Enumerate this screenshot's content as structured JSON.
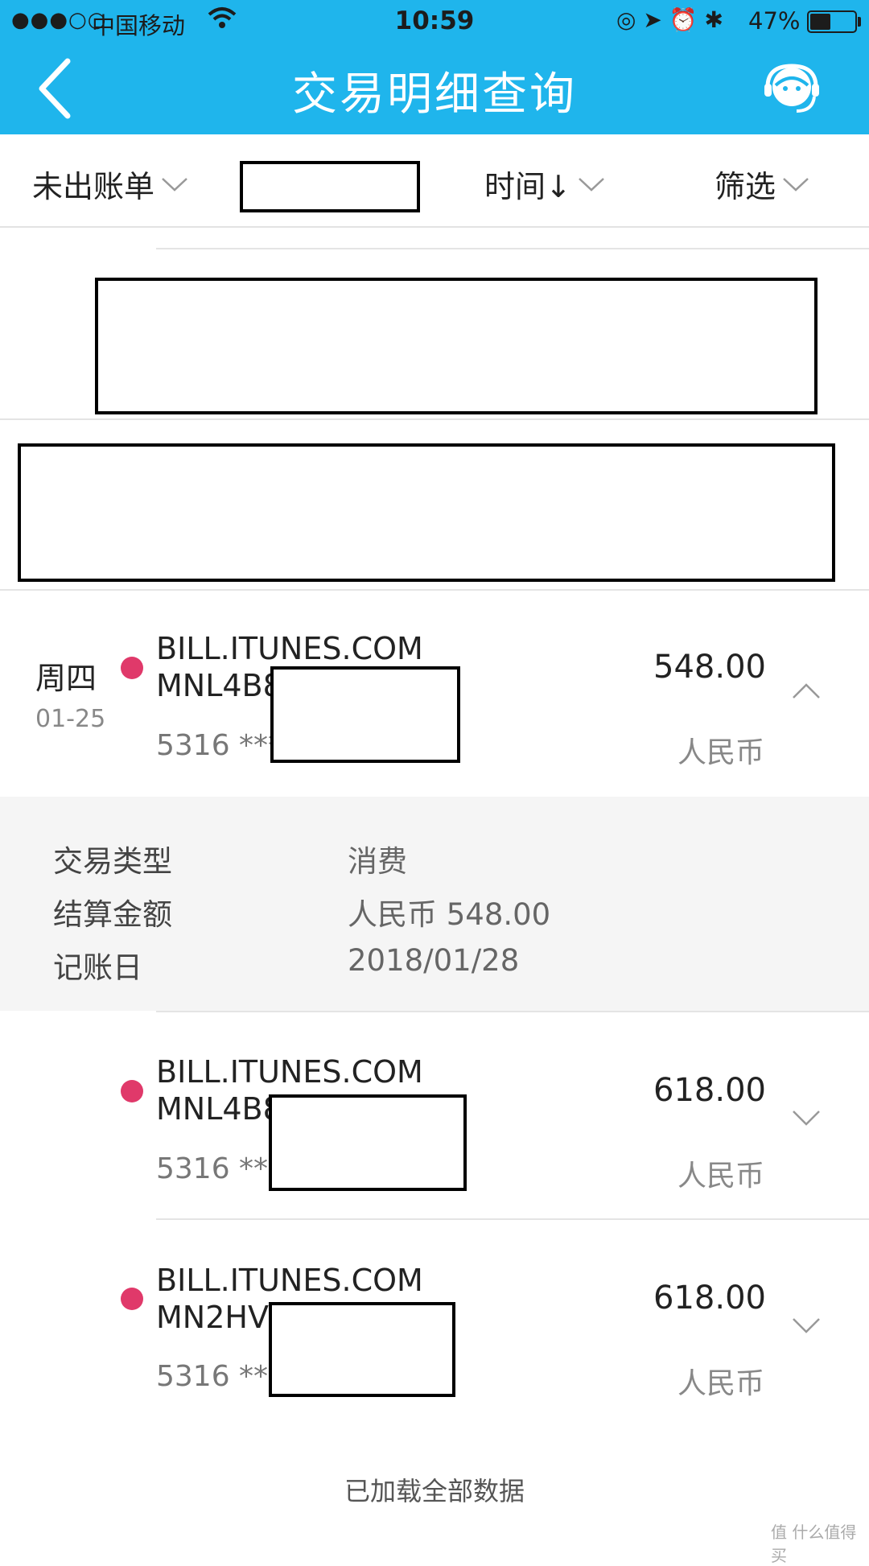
{
  "status_bar": {
    "signal": "●●●○○",
    "carrier": "中国移动",
    "time": "10:59",
    "icons": "◎ ➤ ⏰ ✱",
    "battery_percent": "47%",
    "battery_level": 0.47
  },
  "nav": {
    "title": "交易明细查询",
    "back_icon": "chevron-left-icon",
    "service_icon": "customer-service-icon"
  },
  "filters": {
    "bill": "未出账单",
    "time": "时间↓",
    "screen": "筛选"
  },
  "transactions": [
    {
      "weekday": "周四",
      "date": "01-25",
      "merchant_line1": "BILL.ITUNES.COM",
      "merchant_line2": "MNL4B8",
      "card": "5316 ***",
      "amount": "548.00",
      "currency": "人民币",
      "expanded": true
    },
    {
      "merchant_line1": "BILL.ITUNES.COM",
      "merchant_line2": "MNL4B8",
      "card": "5316 ***",
      "amount": "618.00",
      "currency": "人民币",
      "expanded": false
    },
    {
      "merchant_line1": "BILL.ITUNES.COM",
      "merchant_line2": "MN2HV",
      "card": "5316 ***",
      "amount": "618.00",
      "currency": "人民币",
      "expanded": false
    }
  ],
  "detail": {
    "type_label": "交易类型",
    "type_value": "消费",
    "settle_label": "结算金额",
    "settle_value": "人民币 548.00",
    "post_label": "记账日",
    "post_value": "2018/01/28"
  },
  "footer": "已加载全部数据",
  "watermark": "值 什么值得买",
  "colors": {
    "nav_bg": "#1fb5ec",
    "dot": "#e0396a",
    "detail_bg": "#f5f5f5"
  }
}
